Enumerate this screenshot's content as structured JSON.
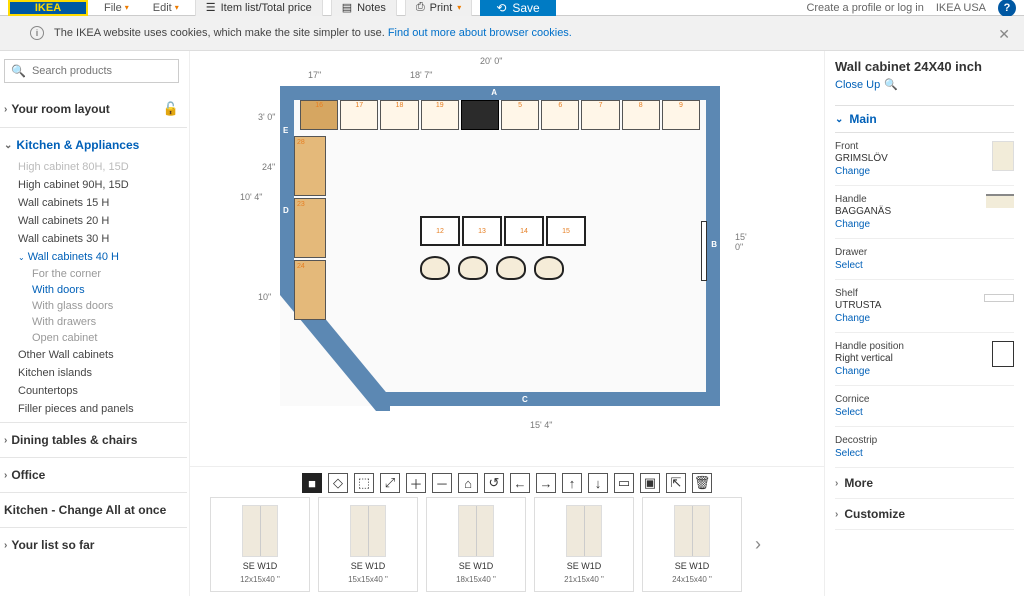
{
  "topbar": {
    "logo_text": "IKEA",
    "file": "File",
    "edit": "Edit",
    "itemlist": "Item list/Total price",
    "notes": "Notes",
    "print": "Print",
    "save": "Save",
    "create_profile": "Create a profile or log in",
    "country": "IKEA USA"
  },
  "cookie": {
    "text": "The IKEA website uses cookies, which make the site simpler to use.",
    "link": "Find out more about browser cookies."
  },
  "search": {
    "placeholder": "Search products"
  },
  "sidebar": {
    "your_room_layout": "Your room layout",
    "kitchen_appliances": "Kitchen & Appliances",
    "items": [
      "High cabinet 80H, 15D",
      "High cabinet 90H, 15D",
      "Wall cabinets 15 H",
      "Wall cabinets 20 H",
      "Wall cabinets 30 H"
    ],
    "wall40": "Wall cabinets 40 H",
    "subitems": [
      "For the corner",
      "With doors",
      "With glass doors",
      "With drawers",
      "Open cabinet"
    ],
    "other_wall": "Other Wall cabinets",
    "kitchen_islands": "Kitchen islands",
    "countertops": "Countertops",
    "filler": "Filler pieces and panels",
    "dining": "Dining tables & chairs",
    "office": "Office",
    "change_all": "Kitchen - Change All at once",
    "list_so_far": "Your list so far"
  },
  "floorplan": {
    "top_dim": "20' 0\"",
    "top_dim_a": "17\"",
    "top_dim_b": "18' 7\"",
    "left_dim_a": "3' 0\"",
    "left_dim_b": "24\"",
    "left_total": "10' 4\"",
    "left_lower": "10\"",
    "right_dim": "15' 0\"",
    "bottom_dim": "15' 4\"",
    "letters": {
      "a": "A",
      "b": "B",
      "c": "C",
      "d": "D",
      "e": "E"
    }
  },
  "products": [
    {
      "name": "SE W1D",
      "dim": "12x15x40 \""
    },
    {
      "name": "SE W1D",
      "dim": "15x15x40 \""
    },
    {
      "name": "SE W1D",
      "dim": "18x15x40 \""
    },
    {
      "name": "SE W1D",
      "dim": "21x15x40 \""
    },
    {
      "name": "SE W1D",
      "dim": "24x15x40 \""
    }
  ],
  "rightpanel": {
    "title": "Wall cabinet 24X40 inch",
    "closeup": "Close Up",
    "main": "Main",
    "items": {
      "front": {
        "label": "Front",
        "value": "GRIMSLÖV",
        "action": "Change"
      },
      "handle": {
        "label": "Handle",
        "value": "BAGGANÄS",
        "action": "Change"
      },
      "drawer": {
        "label": "Drawer",
        "action": "Select"
      },
      "shelf": {
        "label": "Shelf",
        "value": "UTRUSTA",
        "action": "Change"
      },
      "handle_pos": {
        "label": "Handle position",
        "value": "Right vertical",
        "action": "Change"
      },
      "cornice": {
        "label": "Cornice",
        "action": "Select"
      },
      "decostrip": {
        "label": "Decostrip",
        "action": "Select"
      }
    },
    "more": "More",
    "customize": "Customize"
  }
}
